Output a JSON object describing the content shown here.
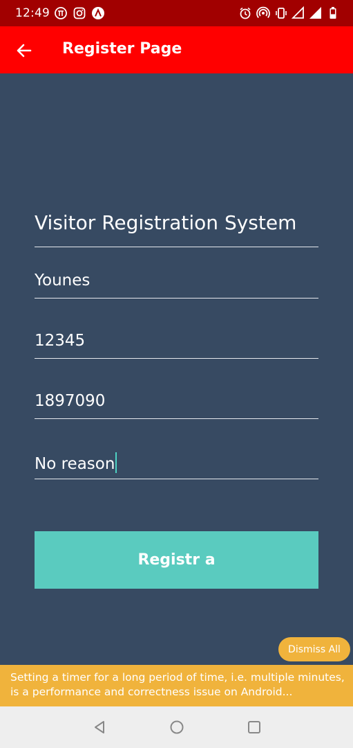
{
  "status_bar": {
    "time": "12:49",
    "left_icons": [
      "pi-icon",
      "instagram-icon",
      "react-native-icon"
    ],
    "right_icons": [
      "alarm-icon",
      "hotspot-icon",
      "vibrate-icon",
      "signal-icon",
      "signal-full-icon",
      "battery-icon"
    ]
  },
  "app_bar": {
    "title": "Register Page",
    "back_icon": "arrow-left-icon",
    "color": "#ff0000"
  },
  "form": {
    "heading": "Visitor Registration System",
    "fields": [
      {
        "value": "Younes"
      },
      {
        "value": "12345"
      },
      {
        "value": "1897090"
      },
      {
        "value": "No reason"
      }
    ],
    "submit_label": "Registr a",
    "submit_color": "#5acbbf"
  },
  "dev_warning": {
    "dismiss_label": "Dismiss All",
    "message": "Setting a timer for a long period of time, i.e. multiple minutes, is a performance and correctness issue on Android..."
  },
  "nav_bar": {
    "icons": [
      "back-triangle-icon",
      "home-circle-icon",
      "recents-square-icon"
    ]
  }
}
